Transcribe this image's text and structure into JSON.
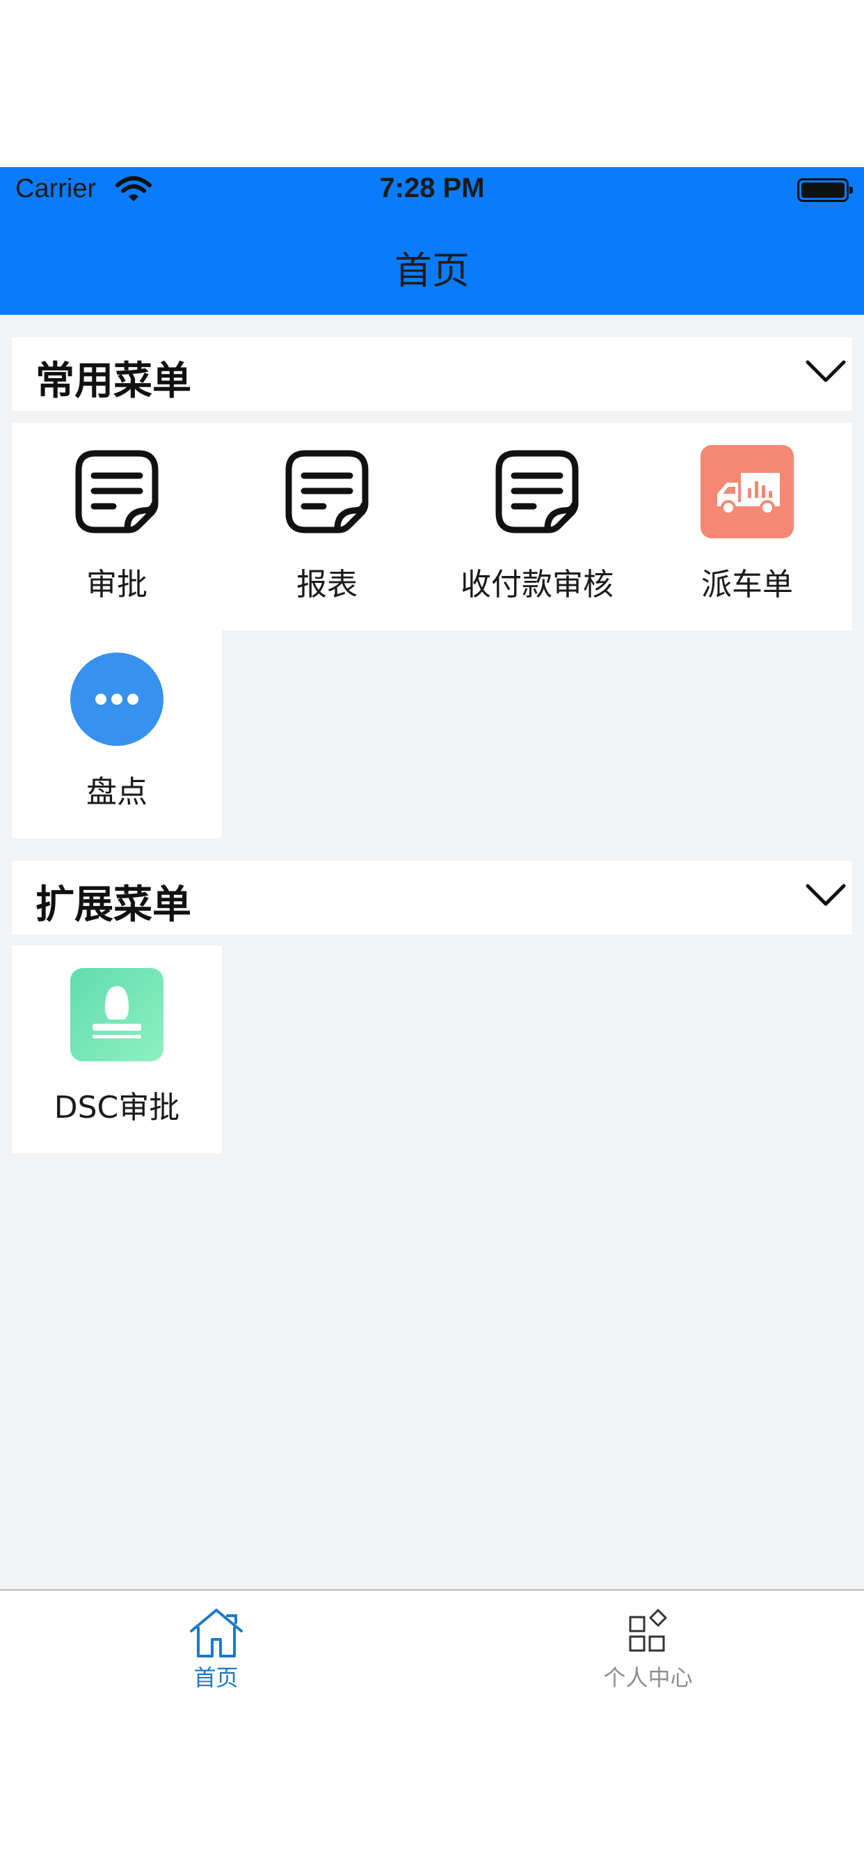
{
  "status_bar": {
    "carrier": "Carrier",
    "time": "7:28 PM",
    "icons": [
      "wifi-icon",
      "battery-icon"
    ]
  },
  "nav": {
    "title": "首页",
    "background": "#087cfb"
  },
  "sections": [
    {
      "title": "常用菜单",
      "items": [
        {
          "label": "审批",
          "icon": "document-icon"
        },
        {
          "label": "报表",
          "icon": "document-icon"
        },
        {
          "label": "收付款审核",
          "icon": "document-icon"
        },
        {
          "label": "派车单",
          "icon": "truck-icon"
        },
        {
          "label": "盘点",
          "icon": "more-dots-icon"
        }
      ]
    },
    {
      "title": "扩展菜单",
      "items": [
        {
          "label": "DSC审批",
          "icon": "stamp-icon"
        }
      ]
    }
  ],
  "tab_bar": {
    "tabs": [
      {
        "label": "首页",
        "icon": "home-icon",
        "active": true
      },
      {
        "label": "个人中心",
        "icon": "apps-icon",
        "active": false
      }
    ],
    "active_color": "#1c79c7",
    "inactive_color": "#8e8e8e"
  },
  "colors": {
    "page_background": "#f2f3f5",
    "truck_tile": "#f58874",
    "more_tile": "#3791ef",
    "stamp_tile": "#6edfb2"
  }
}
